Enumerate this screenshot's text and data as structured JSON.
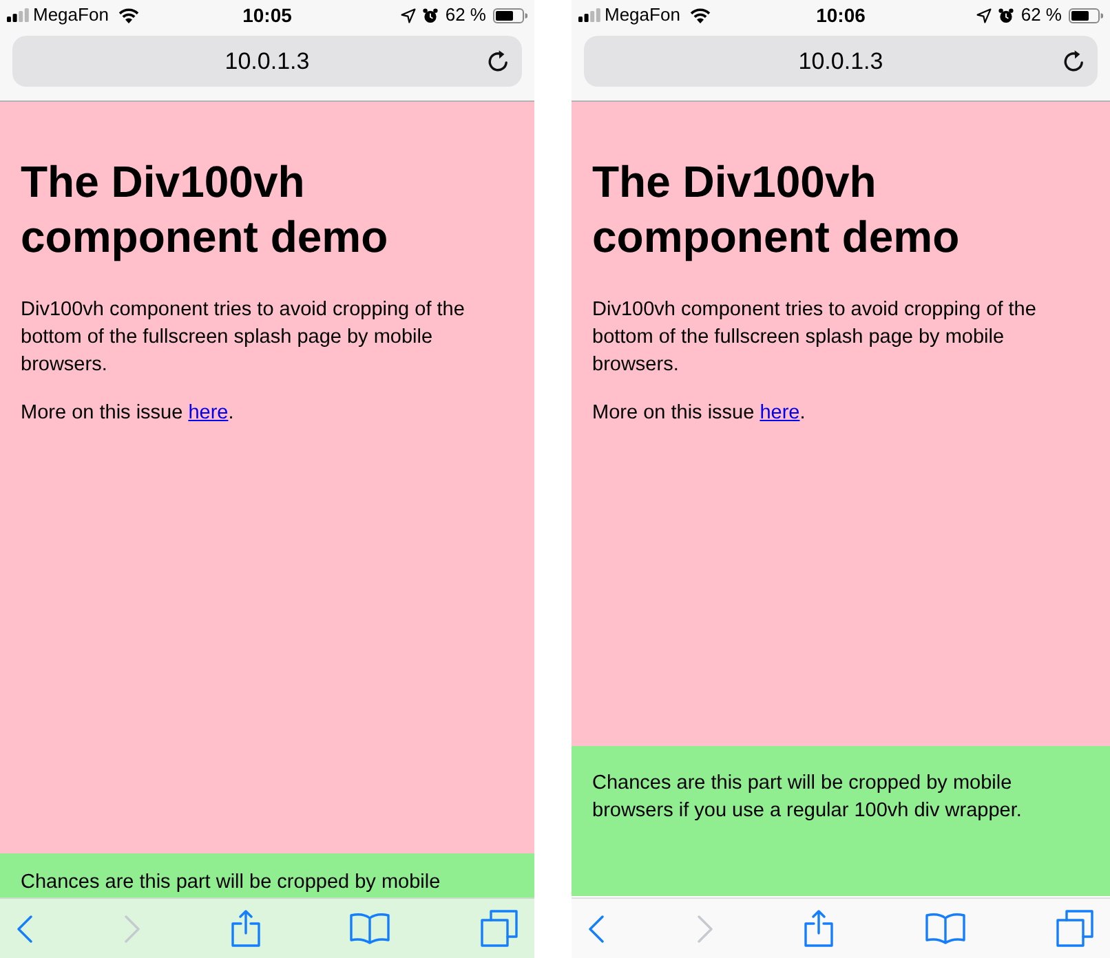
{
  "screens": [
    {
      "status_bar": {
        "carrier": "MegaFon",
        "time": "10:05",
        "battery": "62 %"
      },
      "address_bar": {
        "url": "10.0.1.3"
      },
      "splash": {
        "heading": "The Div100vh component demo",
        "intro": "Div100vh component tries to avoid cropping of the bottom of the fullscreen splash page by mobile browsers.",
        "more": {
          "text": "More on this issue",
          "link": "here",
          "tail": "."
        }
      },
      "footer": {
        "text": "Chances are this part will be cropped by mobile"
      },
      "toolbar": [
        {
          "kind": "back",
          "disabled": false
        },
        {
          "kind": "forward",
          "disabled": true
        },
        {
          "kind": "share",
          "disabled": false
        },
        {
          "kind": "bookmarks",
          "disabled": false
        },
        {
          "kind": "tabs",
          "disabled": false
        }
      ]
    },
    {
      "status_bar": {
        "carrier": "MegaFon",
        "time": "10:06",
        "battery": "62 %"
      },
      "address_bar": {
        "url": "10.0.1.3"
      },
      "splash": {
        "heading": "The Div100vh component demo",
        "intro": "Div100vh component tries to avoid cropping of the bottom of the fullscreen splash page by mobile browsers.",
        "more": {
          "text": "More on this issue",
          "link": "here",
          "tail": "."
        }
      },
      "footer": {
        "text": "Chances are this part will be cropped by mobile browsers if you use a regular 100vh div wrapper."
      },
      "toolbar": [
        {
          "kind": "back",
          "disabled": false
        },
        {
          "kind": "forward",
          "disabled": true
        },
        {
          "kind": "share",
          "disabled": false
        },
        {
          "kind": "bookmarks",
          "disabled": false
        },
        {
          "kind": "tabs",
          "disabled": false
        }
      ]
    }
  ]
}
